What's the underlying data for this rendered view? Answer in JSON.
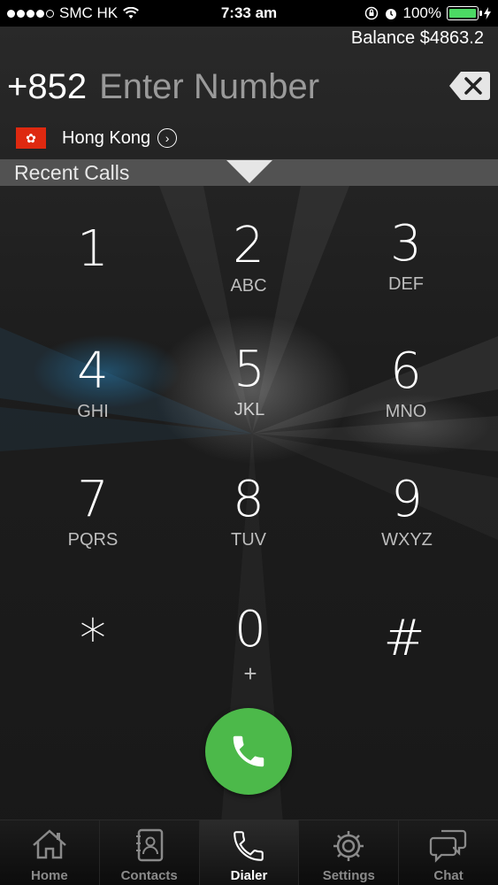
{
  "status_bar": {
    "carrier": "SMC HK",
    "time": "7:33 am",
    "battery": "100%"
  },
  "balance": "Balance $4863.2",
  "dialer": {
    "country_code": "+852",
    "number_placeholder": "Enter Number",
    "country_name": "Hong Kong",
    "flag_icon": "hong-kong-flag-icon"
  },
  "recent_calls_label": "Recent Calls",
  "keypad": [
    {
      "digit": "1",
      "letters": ""
    },
    {
      "digit": "2",
      "letters": "ABC"
    },
    {
      "digit": "3",
      "letters": "DEF"
    },
    {
      "digit": "4",
      "letters": "GHI"
    },
    {
      "digit": "5",
      "letters": "JKL"
    },
    {
      "digit": "6",
      "letters": "MNO"
    },
    {
      "digit": "7",
      "letters": "PQRS"
    },
    {
      "digit": "8",
      "letters": "TUV"
    },
    {
      "digit": "9",
      "letters": "WXYZ"
    },
    {
      "digit": "*",
      "letters": ""
    },
    {
      "digit": "0",
      "letters": "+"
    },
    {
      "digit": "#",
      "letters": ""
    }
  ],
  "tabs": [
    {
      "label": "Home",
      "icon": "home-icon",
      "active": false
    },
    {
      "label": "Contacts",
      "icon": "contacts-icon",
      "active": false
    },
    {
      "label": "Dialer",
      "icon": "phone-icon",
      "active": true
    },
    {
      "label": "Settings",
      "icon": "gear-icon",
      "active": false
    },
    {
      "label": "Chat",
      "icon": "chat-icon",
      "active": false
    }
  ],
  "colors": {
    "call_button": "#4cb94a",
    "battery_fill": "#4cd964",
    "recent_bar": "#525252"
  }
}
